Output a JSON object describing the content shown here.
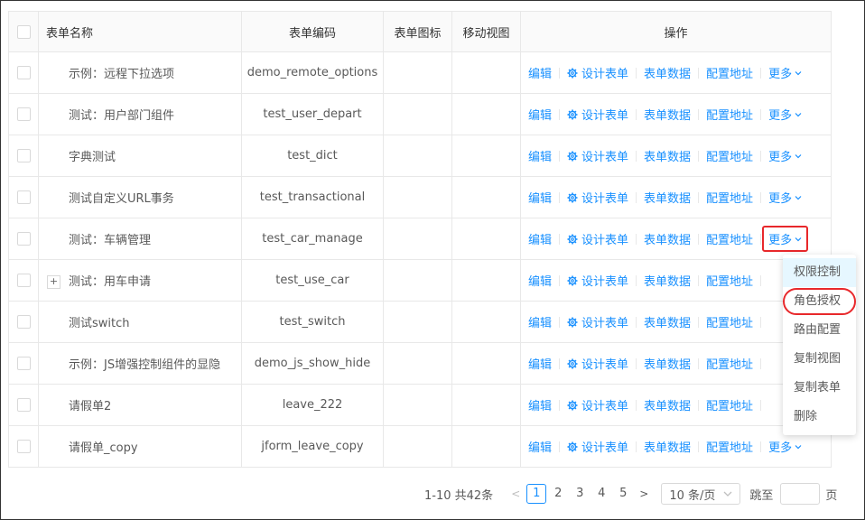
{
  "columns": {
    "name": "表单名称",
    "code": "表单编码",
    "icon": "表单图标",
    "mobile": "移动视图",
    "ops": "操作"
  },
  "rows": [
    {
      "name": "示例：远程下拉选项",
      "code": "demo_remote_options",
      "expandable": false
    },
    {
      "name": "测试：用户部门组件",
      "code": "test_user_depart",
      "expandable": false
    },
    {
      "name": "字典测试",
      "code": "test_dict",
      "expandable": false
    },
    {
      "name": "测试自定义URL事务",
      "code": "test_transactional",
      "expandable": false
    },
    {
      "name": "测试：车辆管理",
      "code": "test_car_manage",
      "expandable": false
    },
    {
      "name": "测试：用车申请",
      "code": "test_use_car",
      "expandable": true
    },
    {
      "name": "测试switch",
      "code": "test_switch",
      "expandable": false
    },
    {
      "name": "示例：JS增强控制组件的显隐",
      "code": "demo_js_show_hide",
      "expandable": false
    },
    {
      "name": "请假单2",
      "code": "leave_222",
      "expandable": false
    },
    {
      "name": "请假单_copy",
      "code": "jform_leave_copy",
      "expandable": false
    }
  ],
  "actions": {
    "edit": "编辑",
    "design": "设计表单",
    "data": "表单数据",
    "config": "配置地址",
    "more": "更多"
  },
  "more_menu": [
    "权限控制",
    "角色授权",
    "路由配置",
    "复制视图",
    "复制表单",
    "删除"
  ],
  "pagination": {
    "total": "1-10 共42条",
    "pages": [
      "1",
      "2",
      "3",
      "4",
      "5"
    ],
    "current": "1",
    "page_size": "10 条/页",
    "jump_label": "跳至",
    "page_unit": "页"
  },
  "colors": {
    "link": "#1890ff",
    "highlight": "#e8282b",
    "menu_hover": "#e6f7ff"
  },
  "icons": {
    "gear": "gear-icon",
    "chevron": "chevron-down-icon",
    "expand": "plus-icon"
  }
}
